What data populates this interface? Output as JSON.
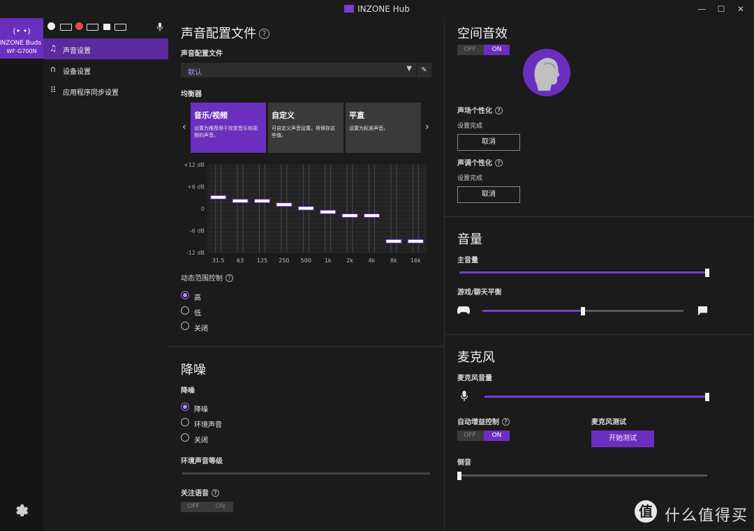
{
  "window": {
    "title": "INZONE Hub",
    "controls": [
      "—",
      "☐",
      "✕"
    ]
  },
  "device": {
    "name": "INZONE Buds",
    "model": "WF-G700N"
  },
  "nav": {
    "items": [
      {
        "label": "声音设置",
        "icon": "music-note-icon",
        "active": true
      },
      {
        "label": "设备设置",
        "icon": "headphones-icon",
        "active": false
      },
      {
        "label": "应用程序同步设置",
        "icon": "grid-icon",
        "active": false
      }
    ]
  },
  "sound": {
    "title": "声音配置文件",
    "profile_label": "声音配置文件",
    "profile_value": "默认",
    "eq_label": "均衡器",
    "presets": [
      {
        "title": "音乐/视频",
        "desc": "设置为推荐用于欣赏音乐和视频的声音。",
        "active": true
      },
      {
        "title": "自定义",
        "desc": "可自定义声音设置。将保存这些值。",
        "active": false
      },
      {
        "title": "平直",
        "desc": "设置为标准声音。",
        "active": false
      }
    ],
    "eq": {
      "y_ticks": [
        "+12 dB",
        "+6 dB",
        "0",
        "-6 dB",
        "-12 dB"
      ],
      "ylim": [
        -12,
        12
      ],
      "bands": [
        "31.5",
        "63",
        "125",
        "250",
        "500",
        "1k",
        "2k",
        "4k",
        "8k",
        "16k"
      ],
      "values": [
        3,
        2,
        2,
        1,
        0,
        -1,
        -2,
        -2,
        -9,
        -9
      ]
    },
    "drc_label": "动态范围控制",
    "drc_options": [
      {
        "label": "高",
        "selected": true
      },
      {
        "label": "低",
        "selected": false
      },
      {
        "label": "关闭",
        "selected": false
      }
    ]
  },
  "anc": {
    "title": "降噪",
    "label": "降噪",
    "options": [
      {
        "label": "降噪",
        "selected": true
      },
      {
        "label": "环境声音",
        "selected": false
      },
      {
        "label": "关闭",
        "selected": false
      }
    ],
    "ambient_level_label": "环境声音等级",
    "focus_voice_label": "关注语音",
    "focus_voice_toggle": {
      "off": "OFF",
      "on": "ON"
    }
  },
  "spatial": {
    "title": "空间音效",
    "toggle": {
      "off": "OFF",
      "on": "ON"
    },
    "field_label": "声场个性化",
    "field_status": "设置完成",
    "field_cancel": "取消",
    "tone_label": "声调个性化",
    "tone_status": "设置完成",
    "tone_cancel": "取消"
  },
  "volume": {
    "title": "音量",
    "master_label": "主音量",
    "master_level": 1.0,
    "balance_label": "游戏/聊天平衡",
    "balance_level": 0.5
  },
  "mic": {
    "title": "麦克风",
    "volume_label": "麦克风音量",
    "volume_level": 1.0,
    "agc_label": "自动增益控制",
    "agc_toggle": {
      "off": "OFF",
      "on": "ON"
    },
    "test_label": "麦克风测试",
    "test_button": "开始测试",
    "sidetone_label": "侧音",
    "sidetone_level": 0.0
  },
  "watermark": {
    "text": "什么值得买"
  },
  "colors": {
    "accent": "#6b2fbf",
    "background": "#1b1b1b"
  }
}
